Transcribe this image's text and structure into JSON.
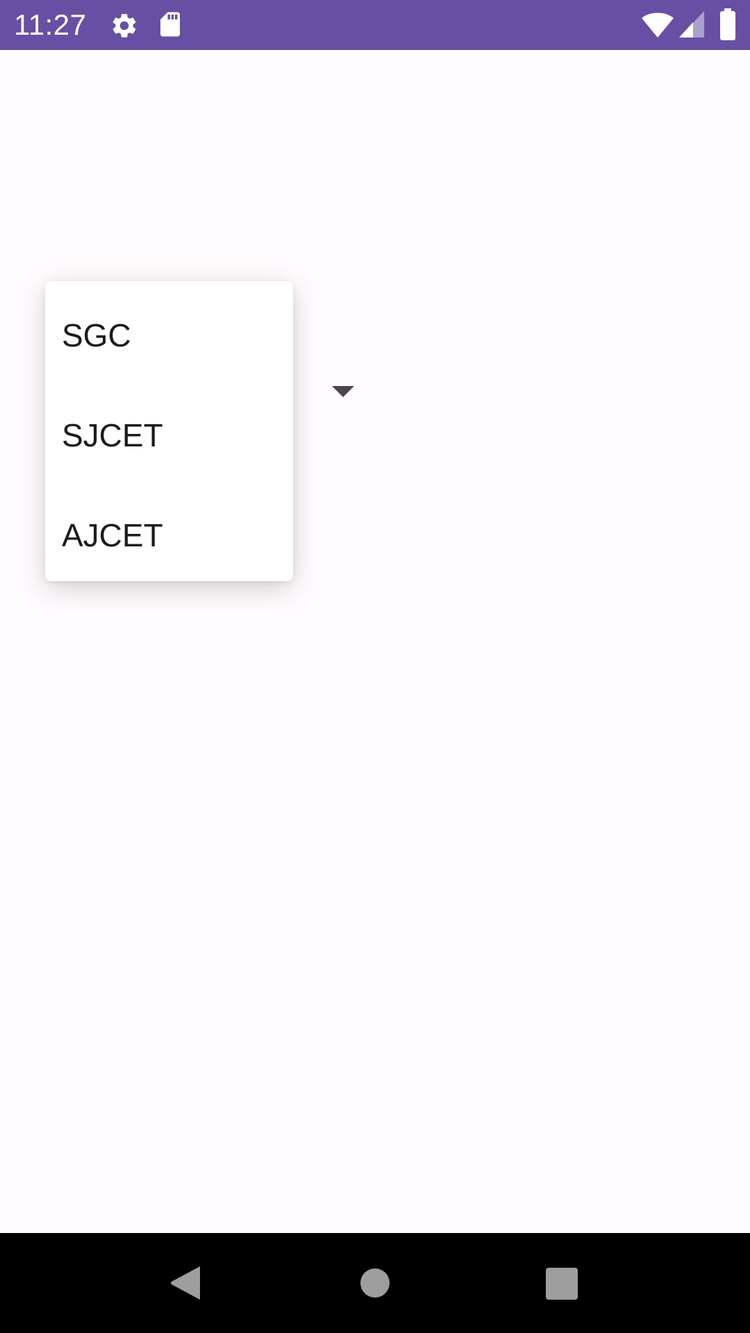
{
  "status_bar": {
    "time": "11:27",
    "background_color": "#6750A4",
    "left_icons": [
      "settings-icon",
      "sd-card-icon"
    ],
    "right_icons": [
      "wifi-icon",
      "cell-signal-icon",
      "battery-icon"
    ]
  },
  "spinner": {
    "arrow_icon": "dropdown-arrow-icon"
  },
  "dropdown": {
    "options": [
      "SGC",
      "SJCET",
      "AJCET"
    ]
  },
  "nav_bar": {
    "buttons": [
      "back-icon",
      "home-icon",
      "recents-icon"
    ]
  }
}
